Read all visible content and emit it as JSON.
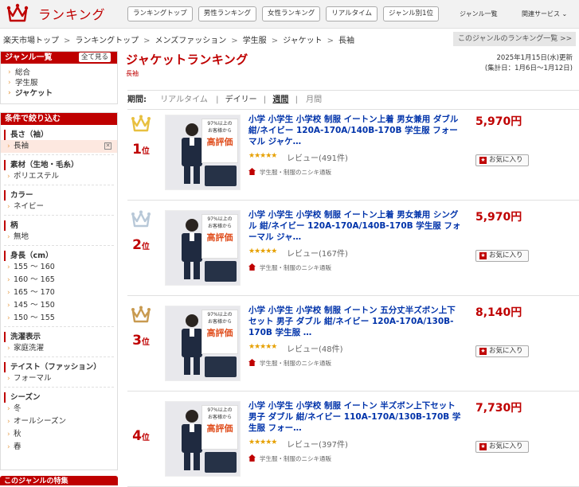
{
  "header": {
    "logo_text": "ランキング",
    "nav": [
      "ランキングトップ",
      "男性ランキング",
      "女性ランキング",
      "リアルタイム",
      "ジャンル別1位"
    ],
    "genre_list": "ジャンル一覧",
    "related": "関連サービス ⌄"
  },
  "breadcrumb": [
    "楽天市場トップ",
    "ランキングトップ",
    "メンズファッション",
    "学生服",
    "ジャケット",
    "長袖"
  ],
  "genre_rank_list_btn": "このジャンルのランキング一覧 >>",
  "sidebar": {
    "genre_title": "ジャンル一覧",
    "show_all": "全て見る",
    "genres": [
      "総合",
      "学生服",
      "ジャケット"
    ],
    "filter_title": "条件で絞り込む",
    "filters": [
      {
        "title": "長さ（袖）",
        "items": [
          "長袖"
        ],
        "selected": 0
      },
      {
        "title": "素材（生地・毛糸）",
        "items": [
          "ポリエステル"
        ]
      },
      {
        "title": "カラー",
        "items": [
          "ネイビー"
        ]
      },
      {
        "title": "柄",
        "items": [
          "無地"
        ]
      },
      {
        "title": "身長（cm）",
        "items": [
          "155 〜 160",
          "160 〜 165",
          "165 〜 170",
          "145 〜 150",
          "150 〜 155"
        ]
      },
      {
        "title": "洗濯表示",
        "items": [
          "家庭洗濯"
        ]
      },
      {
        "title": "テイスト（ファッション）",
        "items": [
          "フォーマル"
        ]
      },
      {
        "title": "シーズン",
        "items": [
          "冬",
          "オールシーズン",
          "秋",
          "春"
        ]
      }
    ],
    "feature_title": "このジャンルの特集"
  },
  "main": {
    "title": "ジャケットランキング",
    "category": "長袖",
    "updated": "2025年1月15日(水)更新",
    "period_range": "(集計日：1月6日〜1月12日)",
    "period_label": "期間:",
    "periods": [
      "リアルタイム",
      "デイリー",
      "週間",
      "月間"
    ],
    "favorite_label": "お気に入り",
    "review_prefix": "レビュー",
    "badge": {
      "line1": "97%以上の",
      "line2": "お客様から",
      "line3": "高評価"
    },
    "items": [
      {
        "rank": "1",
        "rank_unit": "位",
        "crown": "#e8c040",
        "name": "小学 小学生 小学校 制服 イートン上着 男女兼用 ダブル 紺/ネイビー 120A-170A/140B-170B 学生服 フォーマル ジャケ…",
        "stars": "★★★★★",
        "rating": 4.5,
        "reviews": "(491件)",
        "shop": "学生服・制服のニシキ通販",
        "price": "5,970円"
      },
      {
        "rank": "2",
        "rank_unit": "位",
        "crown": "#b8c8d8",
        "name": "小学 小学生 小学校 制服 イートン上着 男女兼用 シングル 紺/ネイビー 120A-170A/140B-170B 学生服 フォーマル ジャ…",
        "stars": "★★★★★",
        "rating": 4.5,
        "reviews": "(167件)",
        "shop": "学生服・制服のニシキ通販",
        "price": "5,970円"
      },
      {
        "rank": "3",
        "rank_unit": "位",
        "crown": "#c89a50",
        "name": "小学 小学生 小学校 制服 イートン 五分丈半ズボン上下セット 男子 ダブル 紺/ネイビー 120A-170A/130B-170B 学生服 …",
        "stars": "★★★★★",
        "rating": 4.5,
        "reviews": "(48件)",
        "shop": "学生服・制服のニシキ通販",
        "price": "8,140円"
      },
      {
        "rank": "4",
        "rank_unit": "位",
        "crown": "",
        "name": "小学 小学生 小学校 制服 イートン 半ズボン上下セット 男子 ダブル 紺/ネイビー 110A-170A/130B-170B 学生服 フォー…",
        "stars": "★★★★★",
        "rating": 4.5,
        "reviews": "(397件)",
        "shop": "学生服・制服のニシキ通販",
        "price": "7,730円"
      }
    ]
  }
}
